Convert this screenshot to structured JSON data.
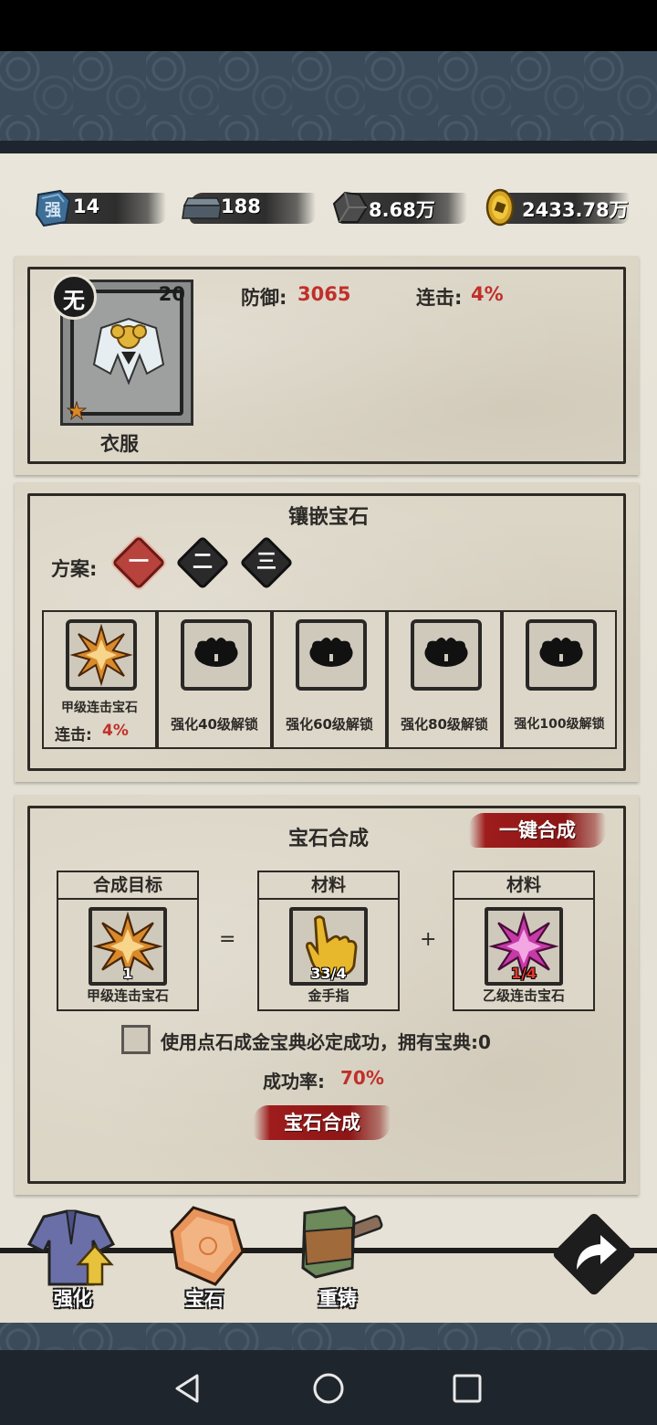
{
  "resources": [
    {
      "icon": "strengthen-stone-icon",
      "value": "14",
      "badge": "强"
    },
    {
      "icon": "iron-ingot-icon",
      "value": "188"
    },
    {
      "icon": "ore-icon",
      "value": "8.68万"
    },
    {
      "icon": "gold-coin-icon",
      "value": "2433.78万"
    }
  ],
  "equipment": {
    "grade_badge": "无",
    "level": "20",
    "name": "衣服",
    "stats": [
      {
        "label": "防御:",
        "value": "3065"
      },
      {
        "label": "连击:",
        "value": "4%"
      }
    ]
  },
  "inlay": {
    "title": "镶嵌宝石",
    "plan_label": "方案:",
    "plans": [
      "一",
      "二",
      "三"
    ],
    "active_plan": 0,
    "slots": [
      {
        "name": "甲级连击宝石",
        "stat_label": "连击:",
        "stat_value": "4%",
        "locked": false
      },
      {
        "label": "强化40级解锁",
        "locked": true
      },
      {
        "label": "强化60级解锁",
        "locked": true
      },
      {
        "label": "强化80级解锁",
        "locked": true
      },
      {
        "label": "强化100级解锁",
        "locked": true
      }
    ]
  },
  "synthesis": {
    "title": "宝石合成",
    "one_click_button": "一键合成",
    "target": {
      "header": "合成目标",
      "name": "甲级连击宝石",
      "count": "1"
    },
    "equals": "=",
    "plus": "+",
    "material1": {
      "header": "材料",
      "name": "金手指",
      "count": "33/4"
    },
    "material2": {
      "header": "材料",
      "name": "乙级连击宝石",
      "count": "1/4"
    },
    "checkbox_label": "使用点石成金宝典必定成功，拥有宝典:0",
    "checkbox_checked": false,
    "rate_label": "成功率:",
    "rate_value": "70%",
    "synthesize_button": "宝石合成"
  },
  "tabs": [
    {
      "label": "强化",
      "icon": "robe-upgrade-icon"
    },
    {
      "label": "宝石",
      "icon": "gem-tab-icon"
    },
    {
      "label": "重铸",
      "icon": "hammer-icon"
    }
  ],
  "colors": {
    "accent_red": "#c0302a",
    "ink": "#2d2a26",
    "paper": "#dcd6c7"
  }
}
